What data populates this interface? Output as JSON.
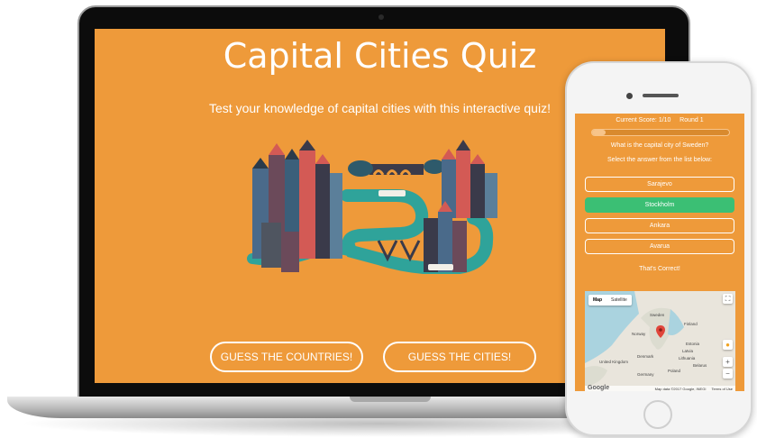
{
  "laptop": {
    "title": "Capital Cities Quiz",
    "subtitle": "Test your knowledge of capital cities with this interactive quiz!",
    "buttons": {
      "countries": "GUESS THE COUNTRIES!",
      "cities": "GUESS THE CITIES!"
    }
  },
  "phone": {
    "score_line": "Current Score: 1/10     Round 1",
    "progress": 0.1,
    "question": "What is the capital city of Sweden?",
    "instruction": "Select the answer from the list below:",
    "answers": [
      "Sarajevo",
      "Stockholm",
      "Ankara",
      "Avarua"
    ],
    "correct_answer": "Stockholm",
    "feedback": "That's Correct!",
    "map": {
      "tabs": [
        "Map",
        "Satellite"
      ],
      "active_tab": "Map",
      "labels": [
        "Sweden",
        "Finland",
        "Norway",
        "Estonia",
        "Latvia",
        "Lithuania",
        "Denmark",
        "United Kingdom",
        "Poland",
        "Belarus",
        "Germany"
      ],
      "google_logo": "Google",
      "attribution": "Map data ©2017 Google, INEGI",
      "terms": "Terms of Use",
      "zoom_in": "+",
      "zoom_out": "−"
    }
  },
  "colors": {
    "orange": "#ee9a3a",
    "correct_green": "#3bbf74",
    "river": "#2fa39a"
  }
}
